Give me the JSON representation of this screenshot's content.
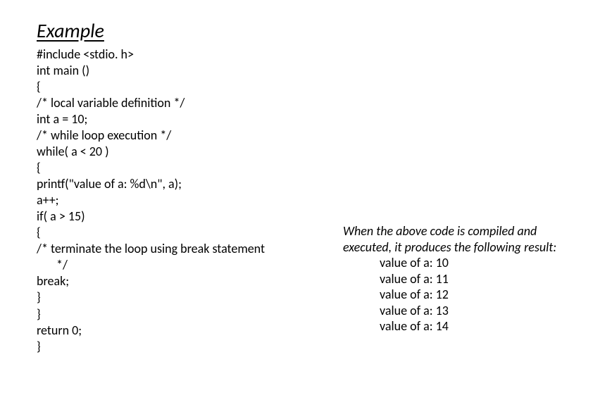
{
  "title": "Example",
  "code": {
    "lines": [
      "#include <stdio. h>",
      "int main ()",
      "{",
      "/* local variable definition */",
      "int a = 10;",
      "/* while loop execution */",
      "while( a < 20 )",
      "{",
      "printf(\"value of a: %d\\n\", a);",
      "a++;",
      "if( a > 15)",
      "{",
      "/* terminate the loop using break statement"
    ],
    "indented": "*/",
    "tail": [
      "break;",
      "}",
      "}",
      "return 0;",
      "}"
    ]
  },
  "result": {
    "intro": "When the above code is compiled and executed, it produces the following result:",
    "output": [
      "value of a: 10",
      "value of a: 11",
      "value of a: 12",
      "value of a: 13",
      "value of a: 14"
    ]
  }
}
